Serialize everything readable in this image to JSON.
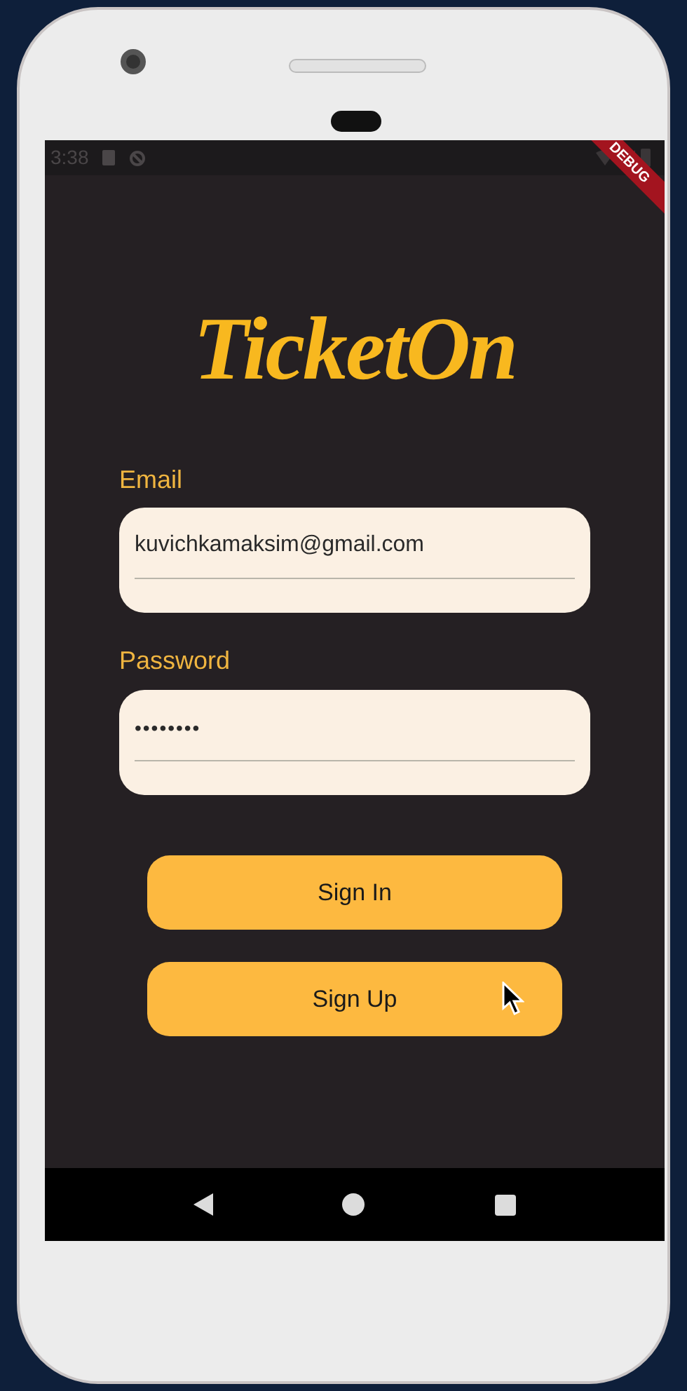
{
  "status_bar": {
    "time": "3:38",
    "banner": "DEBUG"
  },
  "logo": "TicketOn",
  "fields": [
    {
      "kind": "email",
      "label": "Email",
      "value": "kuvichkamaksim@gmail.com"
    },
    {
      "kind": "password",
      "label": "Password",
      "value": "••••••••"
    }
  ],
  "buttons": [
    "Sign In",
    "Sign Up"
  ]
}
